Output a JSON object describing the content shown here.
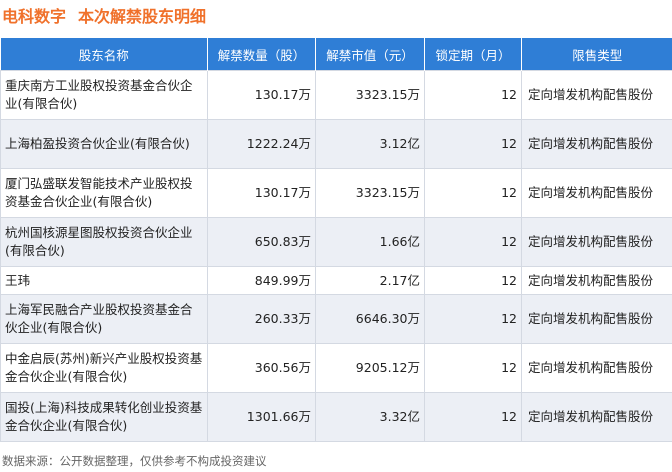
{
  "header": {
    "stock_name": "电科数字",
    "subtitle": "本次解禁股东明细"
  },
  "table": {
    "columns": [
      "股东名称",
      "解禁数量（股）",
      "解禁市值（元）",
      "锁定期（月）",
      "限售类型"
    ],
    "rows": [
      {
        "name": "重庆南方工业股权投资基金合伙企业(有限合伙)",
        "shares": "130.17万",
        "value": "3323.15万",
        "lock": "12",
        "type": "定向增发机构配售股份"
      },
      {
        "name": "上海柏盈投资合伙企业(有限合伙)",
        "shares": "1222.24万",
        "value": "3.12亿",
        "lock": "12",
        "type": "定向增发机构配售股份"
      },
      {
        "name": "厦门弘盛联发智能技术产业股权投资基金合伙企业(有限合伙)",
        "shares": "130.17万",
        "value": "3323.15万",
        "lock": "12",
        "type": "定向增发机构配售股份"
      },
      {
        "name": "杭州国核源星图股权投资合伙企业(有限合伙)",
        "shares": "650.83万",
        "value": "1.66亿",
        "lock": "12",
        "type": "定向增发机构配售股份"
      },
      {
        "name": "王玮",
        "shares": "849.99万",
        "value": "2.17亿",
        "lock": "12",
        "type": "定向增发机构配售股份"
      },
      {
        "name": "上海军民融合产业股权投资基金合伙企业(有限合伙)",
        "shares": "260.33万",
        "value": "6646.30万",
        "lock": "12",
        "type": "定向增发机构配售股份"
      },
      {
        "name": "中金启辰(苏州)新兴产业股权投资基金合伙企业(有限合伙)",
        "shares": "360.56万",
        "value": "9205.12万",
        "lock": "12",
        "type": "定向增发机构配售股份"
      },
      {
        "name": "国投(上海)科技成果转化创业投资基金合伙企业(有限合伙)",
        "shares": "1301.66万",
        "value": "3.32亿",
        "lock": "12",
        "type": "定向增发机构配售股份"
      }
    ]
  },
  "footer": {
    "source": "数据来源：公开数据整理，仅供参考不构成投资建议"
  },
  "colors": {
    "title": "#f0712b",
    "header_bg": "#2f7ed6",
    "alt_row_bg": "#eceff5"
  }
}
